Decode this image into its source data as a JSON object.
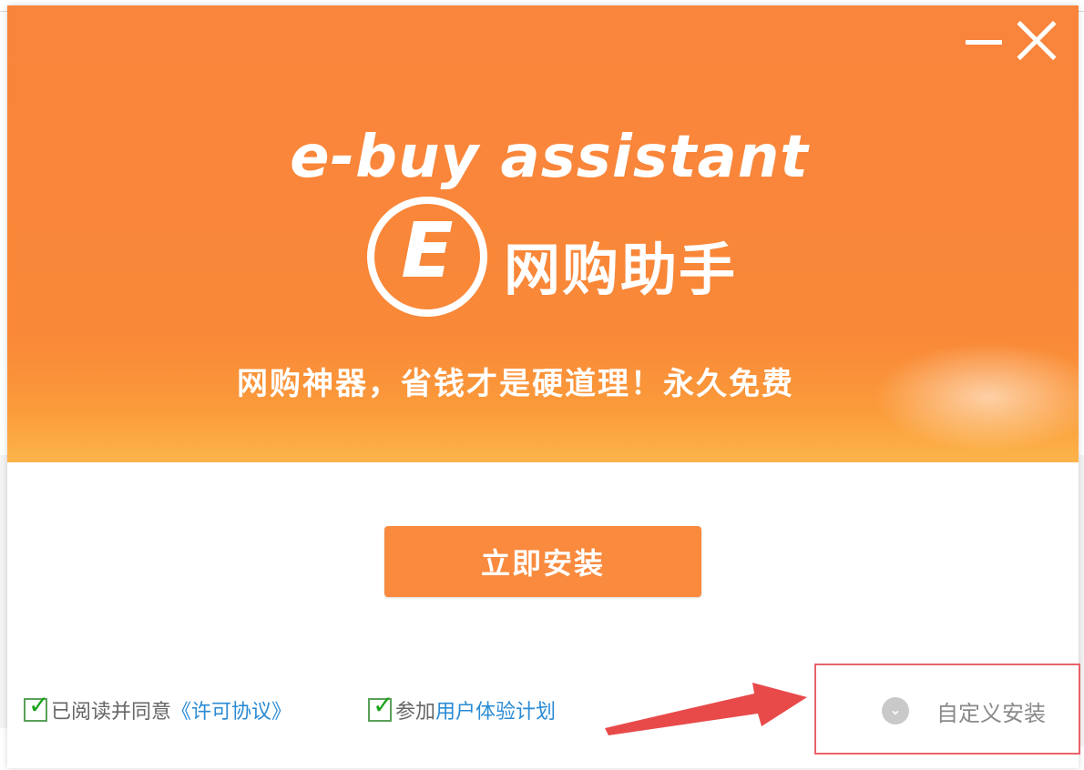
{
  "window": {
    "minimize_icon": "minimize-icon",
    "close_icon": "close-icon"
  },
  "header": {
    "brand_en": "e-buy assistant",
    "logo_letter": "E",
    "brand_cn": "网购助手",
    "slogan": "网购神器，省钱才是硬道理！永久免费",
    "background_color": "#f98838"
  },
  "actions": {
    "install_label": "立即安装",
    "install_color": "#f98a3e"
  },
  "footer": {
    "license_prefix": "已阅读并同意",
    "license_link": "《许可协议》",
    "license_checked": true,
    "ux_prefix": "参加",
    "ux_link": "用户体验计划",
    "ux_checked": true,
    "custom_install_label": "自定义安装",
    "custom_install_icon": "chevron-down-icon",
    "annotation_color": "#e84a4a"
  }
}
